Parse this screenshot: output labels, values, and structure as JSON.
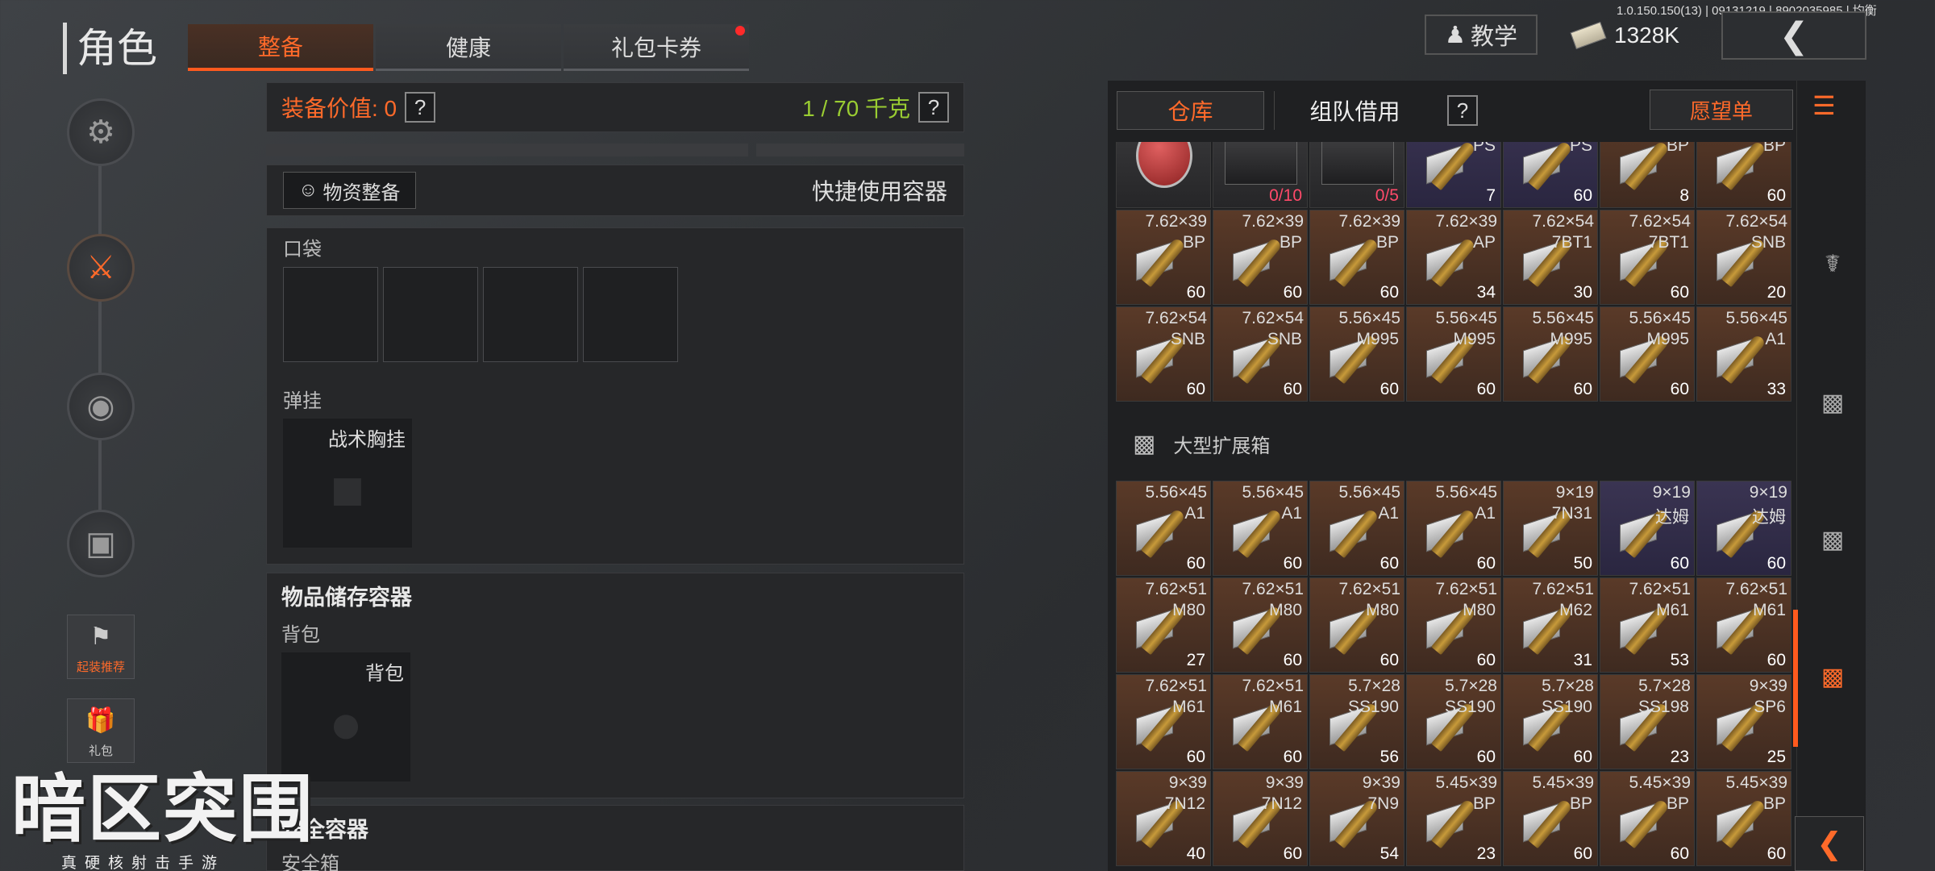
{
  "header": {
    "title": "角色",
    "tabs": [
      {
        "label": "整备",
        "active": true
      },
      {
        "label": "健康",
        "active": false
      },
      {
        "label": "礼包卡券",
        "active": false
      }
    ],
    "version": "1.0.150.150(13) | 09131219 | 8902035985 | 均衡",
    "tutorial_label": "教学",
    "currency": "1328K",
    "back_icon": "chevron-left-icon"
  },
  "left_nav": {
    "items": [
      {
        "name": "helmet-pistol-icon",
        "active": false
      },
      {
        "name": "gear-bag-icon",
        "active": true
      },
      {
        "name": "backpack-icon",
        "active": false
      },
      {
        "name": "case-icon",
        "active": false
      }
    ],
    "recommend_label": "起装推荐",
    "gift_label": "礼包"
  },
  "loadout": {
    "value_label": "装备价值: 0",
    "weight_label": "1 / 70 千克",
    "help": "?",
    "supply_button": "物资整备",
    "quick_container": "快捷使用容器",
    "pocket_label": "口袋",
    "rig_label": "弹挂",
    "rig_slot": "战术胸挂",
    "storage_title": "物品储存容器",
    "backpack_label": "背包",
    "backpack_slot": "背包",
    "safe_title": "安全容器",
    "safe_sub": "安全箱"
  },
  "logo": {
    "main": "暗区突围",
    "sub": "真硬核射击手游"
  },
  "warehouse": {
    "tab_warehouse": "仓库",
    "tab_team": "组队借用",
    "help": "?",
    "wishlist": "愿望单",
    "section_label": "大型扩展箱",
    "colors": {
      "accent": "#ff5a1e",
      "brown": "#4a2e20",
      "purple": "#2e2a44",
      "dark": "#2a2a2a"
    },
    "rows_top": [
      [
        {
          "cal": "",
          "sub": "",
          "count": "",
          "bg": "dark",
          "kind": "grenade"
        },
        {
          "cal": "",
          "sub": "",
          "count": "0/10",
          "bg": "dark",
          "kind": "case"
        },
        {
          "cal": "",
          "sub": "",
          "count": "0/5",
          "bg": "dark",
          "kind": "case"
        },
        {
          "cal": "",
          "sub": "PS",
          "count": "7",
          "bg": "purple",
          "kind": "ammo"
        },
        {
          "cal": "",
          "sub": "PS",
          "count": "60",
          "bg": "purple",
          "kind": "ammo"
        },
        {
          "cal": "",
          "sub": "BP",
          "count": "8",
          "bg": "brown",
          "kind": "ammo"
        },
        {
          "cal": "",
          "sub": "BP",
          "count": "60",
          "bg": "brown",
          "kind": "ammo"
        }
      ],
      [
        {
          "cal": "7.62×39",
          "sub": "BP",
          "count": "60",
          "bg": "brown",
          "kind": "ammo"
        },
        {
          "cal": "7.62×39",
          "sub": "BP",
          "count": "60",
          "bg": "brown",
          "kind": "ammo"
        },
        {
          "cal": "7.62×39",
          "sub": "BP",
          "count": "60",
          "bg": "brown",
          "kind": "ammo"
        },
        {
          "cal": "7.62×39",
          "sub": "AP",
          "count": "34",
          "bg": "brown",
          "kind": "ammo"
        },
        {
          "cal": "7.62×54",
          "sub": "7BT1",
          "count": "30",
          "bg": "brown",
          "kind": "ammo"
        },
        {
          "cal": "7.62×54",
          "sub": "7BT1",
          "count": "60",
          "bg": "brown",
          "kind": "ammo"
        },
        {
          "cal": "7.62×54",
          "sub": "SNB",
          "count": "20",
          "bg": "brown",
          "kind": "ammo"
        }
      ],
      [
        {
          "cal": "7.62×54",
          "sub": "SNB",
          "count": "60",
          "bg": "brown",
          "kind": "ammo"
        },
        {
          "cal": "7.62×54",
          "sub": "SNB",
          "count": "60",
          "bg": "brown",
          "kind": "ammo"
        },
        {
          "cal": "5.56×45",
          "sub": "M995",
          "count": "60",
          "bg": "brown",
          "kind": "ammo"
        },
        {
          "cal": "5.56×45",
          "sub": "M995",
          "count": "60",
          "bg": "brown",
          "kind": "ammo"
        },
        {
          "cal": "5.56×45",
          "sub": "M995",
          "count": "60",
          "bg": "brown",
          "kind": "ammo"
        },
        {
          "cal": "5.56×45",
          "sub": "M995",
          "count": "60",
          "bg": "brown",
          "kind": "ammo"
        },
        {
          "cal": "5.56×45",
          "sub": "A1",
          "count": "33",
          "bg": "brown",
          "kind": "ammo"
        }
      ]
    ],
    "rows_bottom": [
      [
        {
          "cal": "5.56×45",
          "sub": "A1",
          "count": "60",
          "bg": "brown",
          "kind": "ammo"
        },
        {
          "cal": "5.56×45",
          "sub": "A1",
          "count": "60",
          "bg": "brown",
          "kind": "ammo"
        },
        {
          "cal": "5.56×45",
          "sub": "A1",
          "count": "60",
          "bg": "brown",
          "kind": "ammo"
        },
        {
          "cal": "5.56×45",
          "sub": "A1",
          "count": "60",
          "bg": "brown",
          "kind": "ammo"
        },
        {
          "cal": "9×19",
          "sub": "7N31",
          "count": "50",
          "bg": "brown",
          "kind": "ammo"
        },
        {
          "cal": "9×19",
          "sub": "达姆",
          "count": "60",
          "bg": "purple",
          "kind": "ammo"
        },
        {
          "cal": "9×19",
          "sub": "达姆",
          "count": "60",
          "bg": "purple",
          "kind": "ammo"
        }
      ],
      [
        {
          "cal": "7.62×51",
          "sub": "M80",
          "count": "27",
          "bg": "brown",
          "kind": "ammo"
        },
        {
          "cal": "7.62×51",
          "sub": "M80",
          "count": "60",
          "bg": "brown",
          "kind": "ammo"
        },
        {
          "cal": "7.62×51",
          "sub": "M80",
          "count": "60",
          "bg": "brown",
          "kind": "ammo"
        },
        {
          "cal": "7.62×51",
          "sub": "M80",
          "count": "60",
          "bg": "brown",
          "kind": "ammo"
        },
        {
          "cal": "7.62×51",
          "sub": "M62",
          "count": "31",
          "bg": "brown",
          "kind": "ammo"
        },
        {
          "cal": "7.62×51",
          "sub": "M61",
          "count": "53",
          "bg": "brown",
          "kind": "ammo"
        },
        {
          "cal": "7.62×51",
          "sub": "M61",
          "count": "60",
          "bg": "brown",
          "kind": "ammo"
        }
      ],
      [
        {
          "cal": "7.62×51",
          "sub": "M61",
          "count": "60",
          "bg": "brown",
          "kind": "ammo"
        },
        {
          "cal": "7.62×51",
          "sub": "M61",
          "count": "60",
          "bg": "brown",
          "kind": "ammo"
        },
        {
          "cal": "5.7×28",
          "sub": "SS190",
          "count": "56",
          "bg": "brown",
          "kind": "ammo"
        },
        {
          "cal": "5.7×28",
          "sub": "SS190",
          "count": "60",
          "bg": "brown",
          "kind": "ammo"
        },
        {
          "cal": "5.7×28",
          "sub": "SS190",
          "count": "60",
          "bg": "brown",
          "kind": "ammo"
        },
        {
          "cal": "5.7×28",
          "sub": "SS198",
          "count": "23",
          "bg": "brown",
          "kind": "ammo"
        },
        {
          "cal": "9×39",
          "sub": "SP6",
          "count": "25",
          "bg": "brown",
          "kind": "ammo"
        }
      ],
      [
        {
          "cal": "9×39",
          "sub": "7N12",
          "count": "40",
          "bg": "brown",
          "kind": "ammo"
        },
        {
          "cal": "9×39",
          "sub": "7N12",
          "count": "60",
          "bg": "brown",
          "kind": "ammo"
        },
        {
          "cal": "9×39",
          "sub": "7N9",
          "count": "54",
          "bg": "brown",
          "kind": "ammo"
        },
        {
          "cal": "5.45×39",
          "sub": "BP",
          "count": "23",
          "bg": "brown",
          "kind": "ammo"
        },
        {
          "cal": "5.45×39",
          "sub": "BP",
          "count": "60",
          "bg": "brown",
          "kind": "ammo"
        },
        {
          "cal": "5.45×39",
          "sub": "BP",
          "count": "60",
          "bg": "brown",
          "kind": "ammo"
        },
        {
          "cal": "5.45×39",
          "sub": "BP",
          "count": "60",
          "bg": "brown",
          "kind": "ammo"
        }
      ]
    ]
  }
}
